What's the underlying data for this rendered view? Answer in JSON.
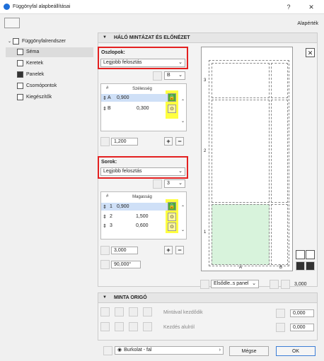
{
  "window": {
    "title": "Függönyfal alapbeállításai",
    "help": "?",
    "close": "✕"
  },
  "header": {
    "defaults_label": "Alapérték"
  },
  "sidebar": {
    "root": "Függönyfalrendszer",
    "items": [
      {
        "label": "Séma",
        "selected": true
      },
      {
        "label": "Keretek"
      },
      {
        "label": "Panelek"
      },
      {
        "label": "Csomópontok"
      },
      {
        "label": "Kiegészítők"
      }
    ]
  },
  "grid_section": {
    "title": "HÁLÓ MINTÁZAT ÉS ELŐNÉZET",
    "columns": {
      "label": "Oszlopok:",
      "mode": "Legjobb felosztás",
      "ref_value": "B",
      "table_headers": [
        "#",
        "Szélesség"
      ],
      "rows": [
        {
          "id": "A",
          "value": "0,900",
          "selected": true
        },
        {
          "id": "B",
          "value": "0,300"
        }
      ],
      "total": "1,200"
    },
    "rows": {
      "label": "Sorok:",
      "mode": "Legjobb felosztás",
      "ref_value": "3",
      "table_headers": [
        "#",
        "Magasság"
      ],
      "rows": [
        {
          "id": "1",
          "value": "0,900",
          "selected": true
        },
        {
          "id": "2",
          "value": "1,500"
        },
        {
          "id": "3",
          "value": "0,600"
        }
      ],
      "total": "3,000",
      "angle": "90,000°"
    },
    "preview": {
      "col_labels": [
        "A",
        "B"
      ],
      "row_labels": [
        "1",
        "2",
        "3"
      ],
      "panel_select": "Elsődle..s panel",
      "height_value": "3,000"
    }
  },
  "origin_section": {
    "title": "MINTA ORIGÓ",
    "pattern_start": "Mintával kezdődik",
    "start_bottom": "Kezdés alulról",
    "value_1": "0,000",
    "value_2": "0,000"
  },
  "footer": {
    "surface_select": "Burkolat - fal",
    "cancel": "Mégse",
    "ok": "OK"
  },
  "colors": {
    "highlight": "#e32020",
    "accent_green": "#4cae34",
    "marker_yellow": "#ffff40"
  }
}
